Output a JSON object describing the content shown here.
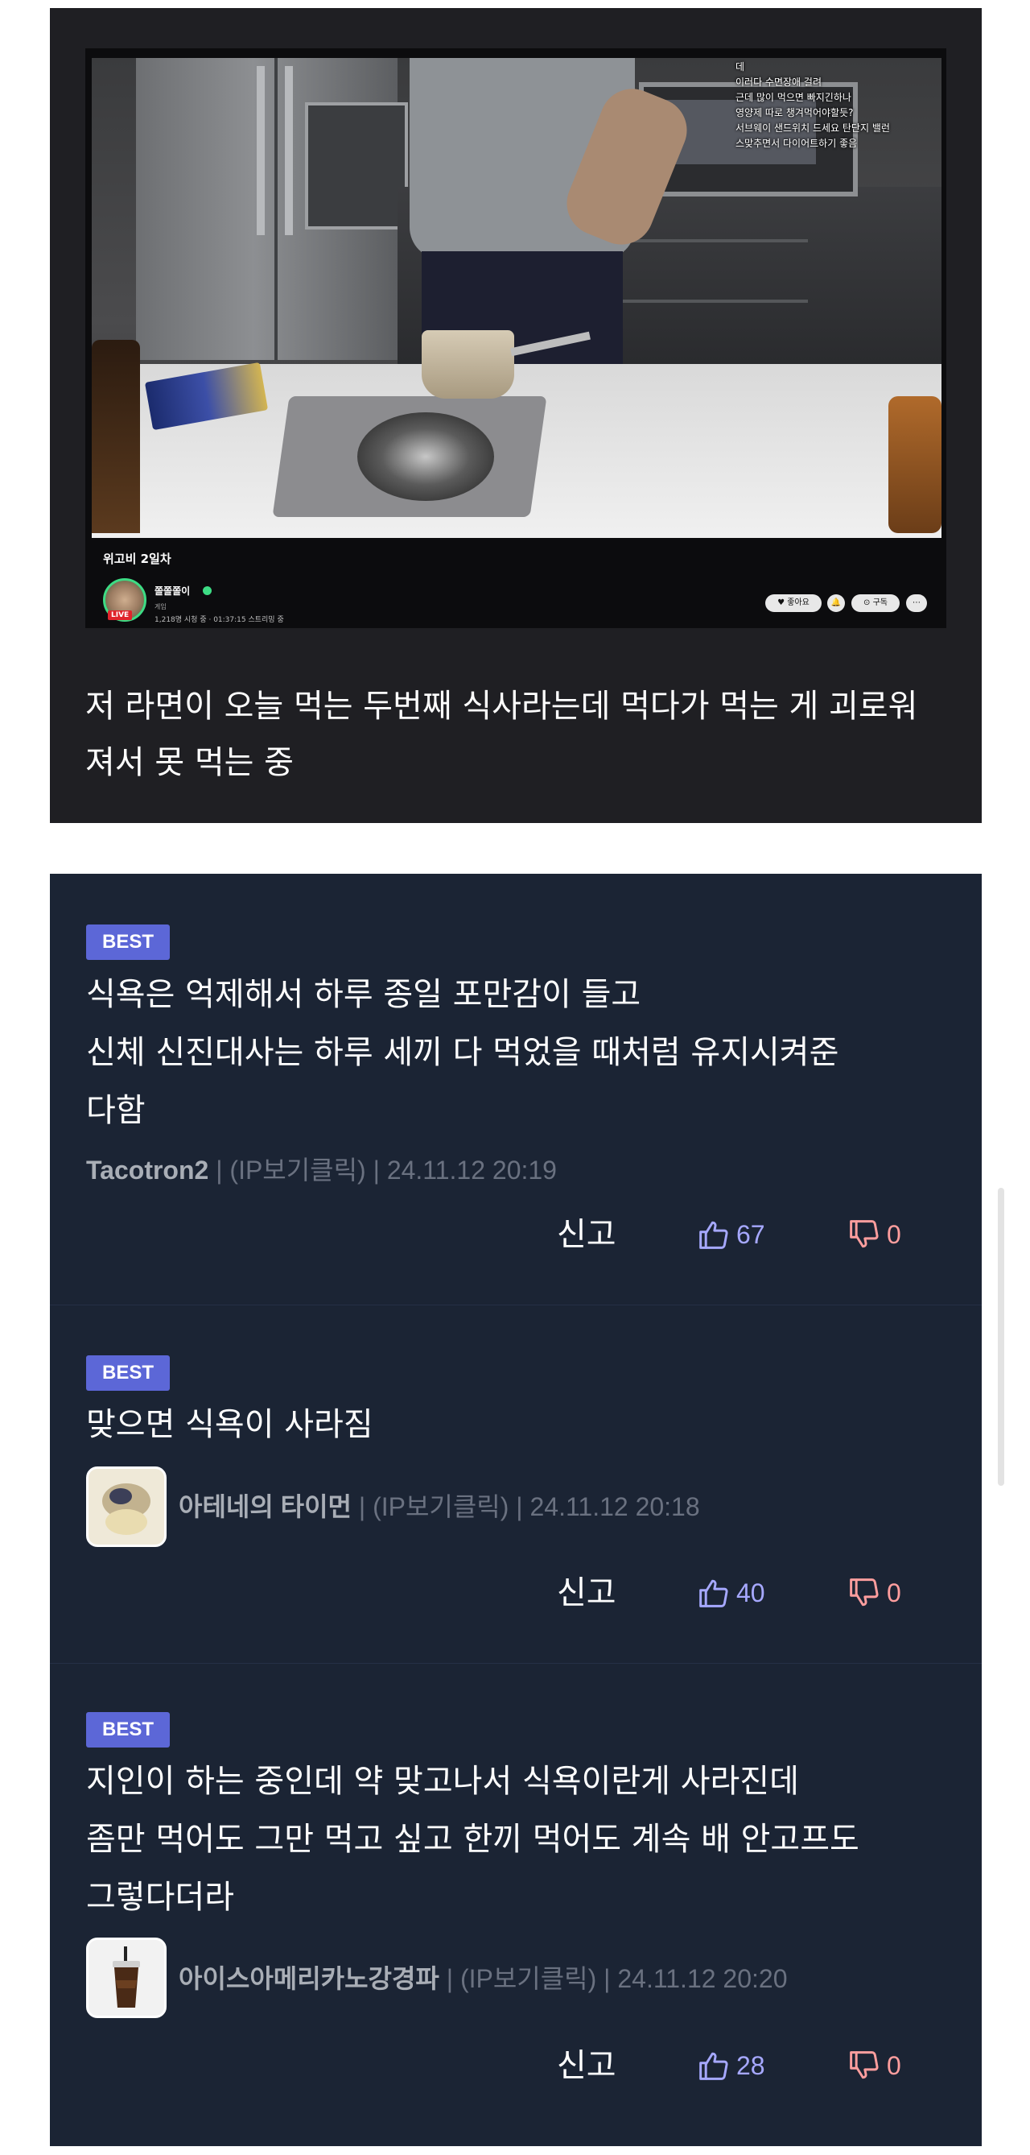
{
  "post": {
    "video": {
      "chat_lines": [
        "데",
        "이러다 수면장애 걸려",
        "근데 많이 먹으면 빠지긴하나",
        "영양제 따로 챙겨먹어야할듯?",
        "서브웨이 샌드위치 드세요 탄단지 밸런",
        "스맞추면서 다이어트하기 좋음"
      ],
      "stream_title": "위고비 2일차",
      "streamer_name": "쫄쫄쫄이",
      "category": "게임",
      "viewers": "1,218명 시청 중 · 01:37:15 스트리밍 중",
      "live_label": "LIVE",
      "buttons": {
        "like": "♥ 좋아요",
        "bell": "🔔",
        "subscribe": "⊙ 구독",
        "more": "⋯"
      }
    },
    "caption": "저 라면이 오늘 먹는 두번째 식사라는데 먹다가 먹는 게 괴로워져서 못 먹는 중"
  },
  "comments": [
    {
      "badge": "BEST",
      "body_lines": [
        "식욕은 억제해서 하루 종일 포만감이 들고",
        "신체 신진대사는 하루 세끼 다 먹었을 때처럼 유지시켜준",
        "다함"
      ],
      "nickname": "Tacotron2",
      "separator": " | ",
      "ip": "(IP보기클릭)",
      "date": "24.11.12 20:19",
      "report": "신고",
      "likes": "67",
      "dislikes": "0"
    },
    {
      "badge": "BEST",
      "body_lines": [
        "맞으면 식욕이 사라짐"
      ],
      "nickname": "아테네의 타이먼",
      "separator": " | ",
      "ip": "(IP보기클릭)",
      "date": "24.11.12 20:18",
      "report": "신고",
      "likes": "40",
      "dislikes": "0"
    },
    {
      "badge": "BEST",
      "body_lines": [
        "지인이 하는 중인데 약 맞고나서 식욕이란게 사라진데",
        "좀만 먹어도 그만 먹고 싶고 한끼 먹어도 계속 배 안고프도",
        "그렇다더라"
      ],
      "nickname": "아이스아메리카노강경파",
      "separator": " | ",
      "ip": "(IP보기클릭)",
      "date": "24.11.12 20:20",
      "report": "신고",
      "likes": "28",
      "dislikes": "0"
    }
  ],
  "colors": {
    "post_bg": "#1f1f23",
    "comments_bg": "#1b2434",
    "best_badge": "#5c67d7",
    "like": "#a6a8ff",
    "dislike": "#ff9e9e"
  },
  "icons": {
    "like": "thumbs-up-icon",
    "dislike": "thumbs-down-icon"
  }
}
